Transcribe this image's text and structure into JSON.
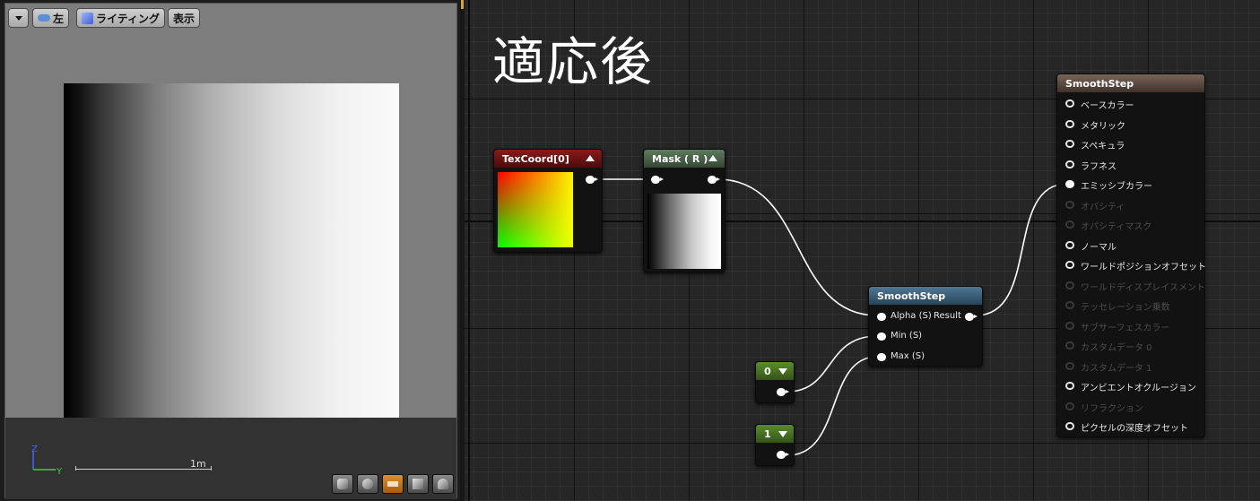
{
  "viewport": {
    "toolbar": {
      "view_label": "左",
      "lighting_label": "ライティング",
      "show_label": "表示"
    },
    "axis": {
      "z": "Z",
      "y": "Y"
    },
    "scale_label": "1m",
    "bottom_buttons": [
      {
        "icon": "cylinder-icon",
        "active": false
      },
      {
        "icon": "sphere-icon",
        "active": false
      },
      {
        "icon": "plane-icon",
        "active": true
      },
      {
        "icon": "cube-icon",
        "active": false
      },
      {
        "icon": "teapot-icon",
        "active": false
      }
    ]
  },
  "graph": {
    "title": "適応後",
    "nodes": {
      "texcoord": {
        "title": "TexCoord[0]",
        "color": "#7a1717"
      },
      "mask": {
        "title": "Mask ( R )",
        "color": "#4f6a4f"
      },
      "smoothstep": {
        "title": "SmoothStep",
        "inputs": [
          "Alpha (S)",
          "Min (S)",
          "Max (S)"
        ],
        "output": "Result",
        "color": "#3f6380"
      },
      "const0": {
        "title": "0",
        "color": "#4a7a22"
      },
      "const1": {
        "title": "1",
        "color": "#4a7a22"
      },
      "result": {
        "title": "SmoothStep",
        "color": "#6a554a",
        "inputs": [
          {
            "label": "ベースカラー",
            "enabled": true
          },
          {
            "label": "メタリック",
            "enabled": true
          },
          {
            "label": "スペキュラ",
            "enabled": true
          },
          {
            "label": "ラフネス",
            "enabled": true
          },
          {
            "label": "エミッシブカラー",
            "enabled": true,
            "connected": true
          },
          {
            "label": "オパシティ",
            "enabled": false
          },
          {
            "label": "オパシティマスク",
            "enabled": false
          },
          {
            "label": "ノーマル",
            "enabled": true
          },
          {
            "label": "ワールドポジションオフセット",
            "enabled": true
          },
          {
            "label": "ワールドディスプレイスメント",
            "enabled": false
          },
          {
            "label": "テッセレーション乗数",
            "enabled": false
          },
          {
            "label": "サブサーフェスカラー",
            "enabled": false
          },
          {
            "label": "カスタムデータ 0",
            "enabled": false
          },
          {
            "label": "カスタムデータ 1",
            "enabled": false
          },
          {
            "label": "アンビエントオクルージョン",
            "enabled": true
          },
          {
            "label": "リフラクション",
            "enabled": false
          },
          {
            "label": "ピクセルの深度オフセット",
            "enabled": true
          }
        ]
      }
    }
  }
}
